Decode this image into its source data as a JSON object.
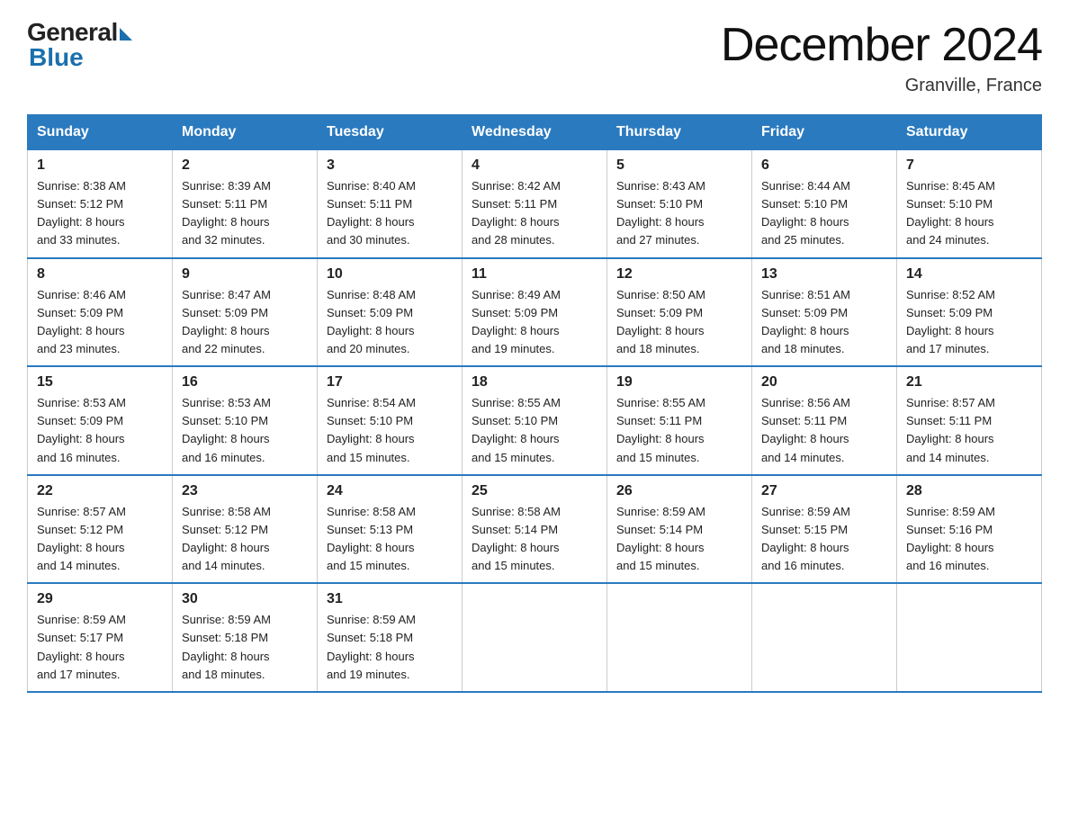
{
  "logo": {
    "general": "General",
    "blue": "Blue"
  },
  "title": "December 2024",
  "location": "Granville, France",
  "days_of_week": [
    "Sunday",
    "Monday",
    "Tuesday",
    "Wednesday",
    "Thursday",
    "Friday",
    "Saturday"
  ],
  "weeks": [
    [
      {
        "day": "1",
        "sunrise": "8:38 AM",
        "sunset": "5:12 PM",
        "daylight": "8 hours and 33 minutes."
      },
      {
        "day": "2",
        "sunrise": "8:39 AM",
        "sunset": "5:11 PM",
        "daylight": "8 hours and 32 minutes."
      },
      {
        "day": "3",
        "sunrise": "8:40 AM",
        "sunset": "5:11 PM",
        "daylight": "8 hours and 30 minutes."
      },
      {
        "day": "4",
        "sunrise": "8:42 AM",
        "sunset": "5:11 PM",
        "daylight": "8 hours and 28 minutes."
      },
      {
        "day": "5",
        "sunrise": "8:43 AM",
        "sunset": "5:10 PM",
        "daylight": "8 hours and 27 minutes."
      },
      {
        "day": "6",
        "sunrise": "8:44 AM",
        "sunset": "5:10 PM",
        "daylight": "8 hours and 25 minutes."
      },
      {
        "day": "7",
        "sunrise": "8:45 AM",
        "sunset": "5:10 PM",
        "daylight": "8 hours and 24 minutes."
      }
    ],
    [
      {
        "day": "8",
        "sunrise": "8:46 AM",
        "sunset": "5:09 PM",
        "daylight": "8 hours and 23 minutes."
      },
      {
        "day": "9",
        "sunrise": "8:47 AM",
        "sunset": "5:09 PM",
        "daylight": "8 hours and 22 minutes."
      },
      {
        "day": "10",
        "sunrise": "8:48 AM",
        "sunset": "5:09 PM",
        "daylight": "8 hours and 20 minutes."
      },
      {
        "day": "11",
        "sunrise": "8:49 AM",
        "sunset": "5:09 PM",
        "daylight": "8 hours and 19 minutes."
      },
      {
        "day": "12",
        "sunrise": "8:50 AM",
        "sunset": "5:09 PM",
        "daylight": "8 hours and 18 minutes."
      },
      {
        "day": "13",
        "sunrise": "8:51 AM",
        "sunset": "5:09 PM",
        "daylight": "8 hours and 18 minutes."
      },
      {
        "day": "14",
        "sunrise": "8:52 AM",
        "sunset": "5:09 PM",
        "daylight": "8 hours and 17 minutes."
      }
    ],
    [
      {
        "day": "15",
        "sunrise": "8:53 AM",
        "sunset": "5:09 PM",
        "daylight": "8 hours and 16 minutes."
      },
      {
        "day": "16",
        "sunrise": "8:53 AM",
        "sunset": "5:10 PM",
        "daylight": "8 hours and 16 minutes."
      },
      {
        "day": "17",
        "sunrise": "8:54 AM",
        "sunset": "5:10 PM",
        "daylight": "8 hours and 15 minutes."
      },
      {
        "day": "18",
        "sunrise": "8:55 AM",
        "sunset": "5:10 PM",
        "daylight": "8 hours and 15 minutes."
      },
      {
        "day": "19",
        "sunrise": "8:55 AM",
        "sunset": "5:11 PM",
        "daylight": "8 hours and 15 minutes."
      },
      {
        "day": "20",
        "sunrise": "8:56 AM",
        "sunset": "5:11 PM",
        "daylight": "8 hours and 14 minutes."
      },
      {
        "day": "21",
        "sunrise": "8:57 AM",
        "sunset": "5:11 PM",
        "daylight": "8 hours and 14 minutes."
      }
    ],
    [
      {
        "day": "22",
        "sunrise": "8:57 AM",
        "sunset": "5:12 PM",
        "daylight": "8 hours and 14 minutes."
      },
      {
        "day": "23",
        "sunrise": "8:58 AM",
        "sunset": "5:12 PM",
        "daylight": "8 hours and 14 minutes."
      },
      {
        "day": "24",
        "sunrise": "8:58 AM",
        "sunset": "5:13 PM",
        "daylight": "8 hours and 15 minutes."
      },
      {
        "day": "25",
        "sunrise": "8:58 AM",
        "sunset": "5:14 PM",
        "daylight": "8 hours and 15 minutes."
      },
      {
        "day": "26",
        "sunrise": "8:59 AM",
        "sunset": "5:14 PM",
        "daylight": "8 hours and 15 minutes."
      },
      {
        "day": "27",
        "sunrise": "8:59 AM",
        "sunset": "5:15 PM",
        "daylight": "8 hours and 16 minutes."
      },
      {
        "day": "28",
        "sunrise": "8:59 AM",
        "sunset": "5:16 PM",
        "daylight": "8 hours and 16 minutes."
      }
    ],
    [
      {
        "day": "29",
        "sunrise": "8:59 AM",
        "sunset": "5:17 PM",
        "daylight": "8 hours and 17 minutes."
      },
      {
        "day": "30",
        "sunrise": "8:59 AM",
        "sunset": "5:18 PM",
        "daylight": "8 hours and 18 minutes."
      },
      {
        "day": "31",
        "sunrise": "8:59 AM",
        "sunset": "5:18 PM",
        "daylight": "8 hours and 19 minutes."
      },
      null,
      null,
      null,
      null
    ]
  ],
  "labels": {
    "sunrise": "Sunrise:",
    "sunset": "Sunset:",
    "daylight": "Daylight:"
  }
}
